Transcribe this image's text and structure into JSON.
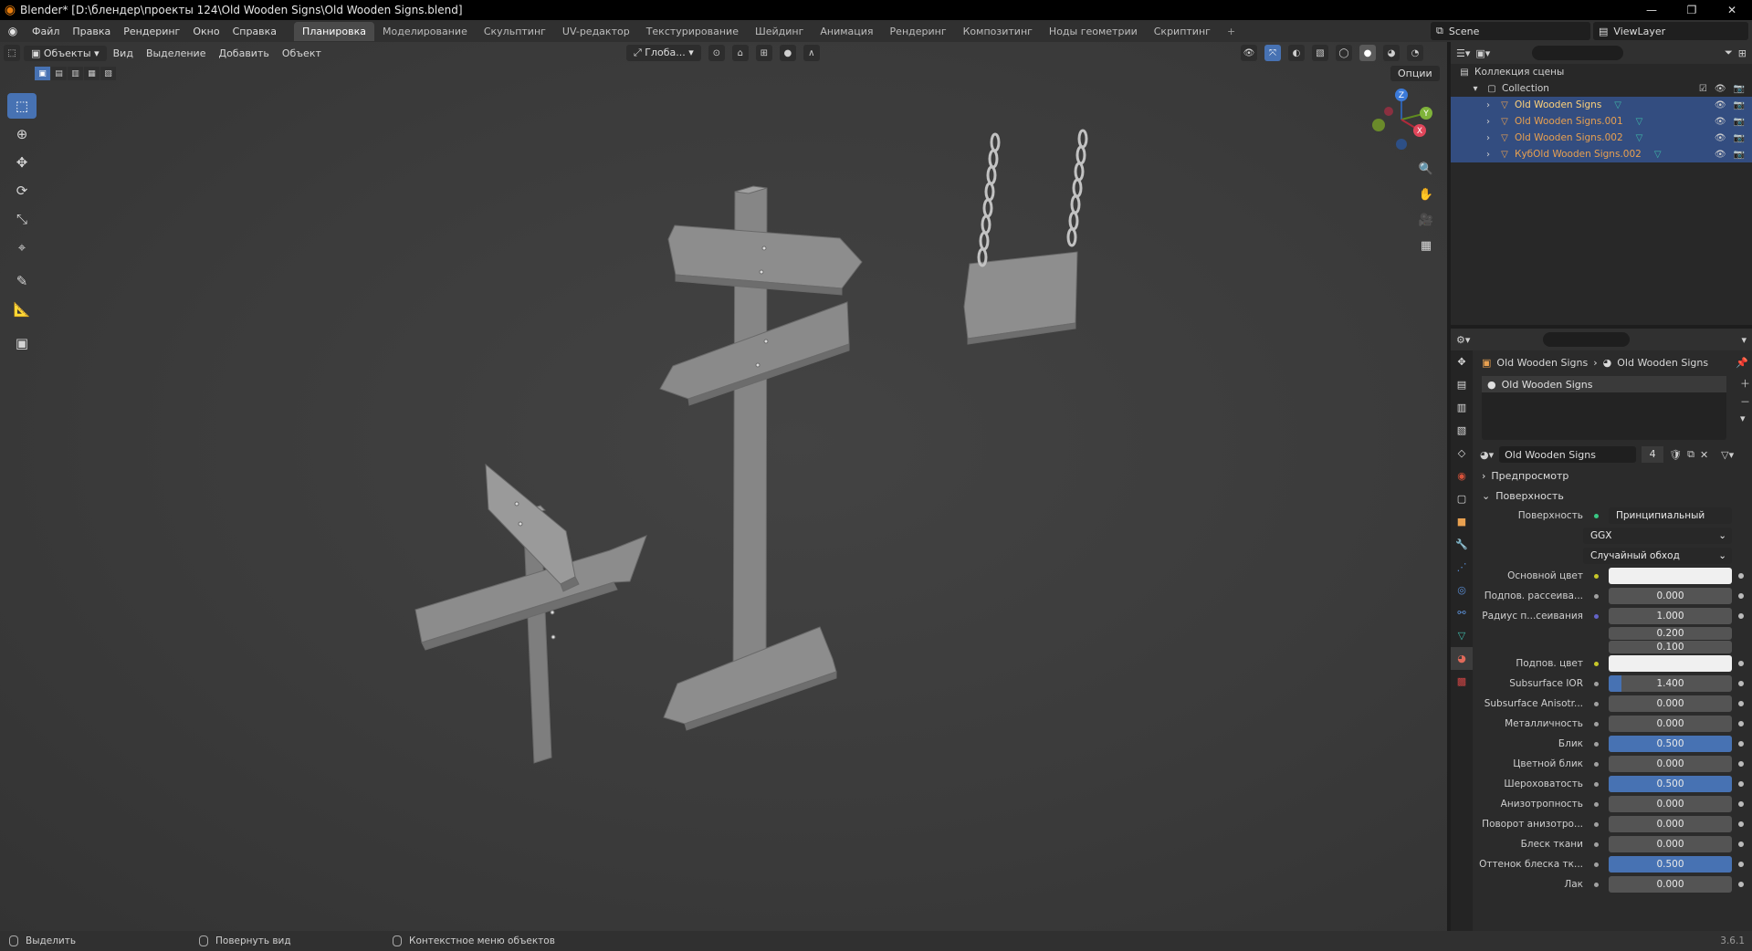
{
  "window": {
    "title": "Blender* [D:\\блендер\\проекты 124\\Old Wooden Signs\\Old Wooden Signs.blend]",
    "minimize": "—",
    "maximize": "❐",
    "close": "✕"
  },
  "topbar": {
    "menu": [
      "Файл",
      "Правка",
      "Рендеринг",
      "Окно",
      "Справка"
    ],
    "workspaces": [
      {
        "label": "Планировка",
        "active": true
      },
      {
        "label": "Моделирование",
        "active": false
      },
      {
        "label": "Скульптинг",
        "active": false
      },
      {
        "label": "UV-редактор",
        "active": false
      },
      {
        "label": "Текстурирование",
        "active": false
      },
      {
        "label": "Шейдинг",
        "active": false
      },
      {
        "label": "Анимация",
        "active": false
      },
      {
        "label": "Рендеринг",
        "active": false
      },
      {
        "label": "Композитинг",
        "active": false
      },
      {
        "label": "Ноды геометрии",
        "active": false
      },
      {
        "label": "Скриптинг",
        "active": false
      }
    ],
    "add_workspace": "+",
    "scene": "Scene",
    "view_layer": "ViewLayer"
  },
  "viewport": {
    "mode": "Объекты",
    "menus": [
      "Вид",
      "Выделение",
      "Добавить",
      "Объект"
    ],
    "transform_orientation": "Глоба...",
    "options": "Опции",
    "gizmo": {
      "x": "X",
      "y": "Y",
      "z": "Z"
    }
  },
  "toolbar": {
    "tools": [
      {
        "name": "select-box-tool",
        "icon": "select-box-icon",
        "glyph": "⬚",
        "active": true
      },
      {
        "name": "cursor-tool",
        "icon": "cursor-icon",
        "glyph": "⊕",
        "active": false
      },
      {
        "name": "move-tool",
        "icon": "move-icon",
        "glyph": "✥",
        "active": false
      },
      {
        "name": "rotate-tool",
        "icon": "rotate-icon",
        "glyph": "⟳",
        "active": false
      },
      {
        "name": "scale-tool",
        "icon": "scale-icon",
        "glyph": "⤡",
        "active": false
      },
      {
        "name": "transform-tool",
        "icon": "transform-icon",
        "glyph": "⌖",
        "active": false
      },
      {
        "name": "annotate-tool",
        "icon": "annotate-icon",
        "glyph": "✎",
        "active": false
      },
      {
        "name": "measure-tool",
        "icon": "measure-icon",
        "glyph": "📐",
        "active": false
      },
      {
        "name": "add-cube-tool",
        "icon": "add-cube-icon",
        "glyph": "▣",
        "active": false
      }
    ]
  },
  "outliner": {
    "scene_collection": "Коллекция сцены",
    "collection": "Collection",
    "objects": [
      {
        "name": "Old Wooden Signs",
        "selected": true,
        "active": true
      },
      {
        "name": "Old Wooden Signs.001",
        "selected": true,
        "active": false
      },
      {
        "name": "Old Wooden Signs.002",
        "selected": true,
        "active": false
      },
      {
        "name": "КубOld Wooden Signs.002",
        "selected": true,
        "active": false
      }
    ]
  },
  "properties": {
    "breadcrumb_object": "Old Wooden Signs",
    "breadcrumb_material": "Old Wooden Signs",
    "slot_name": "Old Wooden Signs",
    "material_name": "Old Wooden Signs",
    "users": "4",
    "preview_panel": "Предпросмотр",
    "surface_panel": "Поверхность",
    "surface_label": "Поверхность",
    "surface_value": "Принципиальный BSDF",
    "distribution": "GGX",
    "subsurface_method": "Случайный обход",
    "rows": [
      {
        "label": "Основной цвет",
        "value": "",
        "kind": "color",
        "dot": "yellow"
      },
      {
        "label": "Подпов. рассеива...",
        "value": "0.000",
        "kind": "num",
        "dot": "grey",
        "fill": 0
      },
      {
        "label": "Радиус п...сеивания",
        "value": "1.000",
        "kind": "num",
        "dot": "blue",
        "fill": 0
      },
      {
        "label": "",
        "value": "0.200",
        "kind": "num",
        "dot": "",
        "fill": 0
      },
      {
        "label": "",
        "value": "0.100",
        "kind": "num",
        "dot": "",
        "fill": 0
      },
      {
        "label": "Подпов. цвет",
        "value": "",
        "kind": "color",
        "dot": "yellow"
      },
      {
        "label": "Subsurface IOR",
        "value": "1.400",
        "kind": "num",
        "dot": "grey",
        "fill": 0.1
      },
      {
        "label": "Subsurface Anisotr...",
        "value": "0.000",
        "kind": "num",
        "dot": "grey",
        "fill": 0
      },
      {
        "label": "Металличность",
        "value": "0.000",
        "kind": "num",
        "dot": "grey",
        "fill": 0
      },
      {
        "label": "Блик",
        "value": "0.500",
        "kind": "num",
        "dot": "grey",
        "fill": 1
      },
      {
        "label": "Цветной блик",
        "value": "0.000",
        "kind": "num",
        "dot": "grey",
        "fill": 0
      },
      {
        "label": "Шероховатость",
        "value": "0.500",
        "kind": "num",
        "dot": "grey",
        "fill": 1
      },
      {
        "label": "Анизотропность",
        "value": "0.000",
        "kind": "num",
        "dot": "grey",
        "fill": 0
      },
      {
        "label": "Поворот анизотро...",
        "value": "0.000",
        "kind": "num",
        "dot": "grey",
        "fill": 0
      },
      {
        "label": "Блеск ткани",
        "value": "0.000",
        "kind": "num",
        "dot": "grey",
        "fill": 0
      },
      {
        "label": "Оттенок блеска тк...",
        "value": "0.500",
        "kind": "num",
        "dot": "grey",
        "fill": 1
      },
      {
        "label": "Лак",
        "value": "0.000",
        "kind": "num",
        "dot": "grey",
        "fill": 0
      }
    ]
  },
  "statusbar": {
    "select": "Выделить",
    "rotate_view": "Повернуть вид",
    "context_menu": "Контекстное меню объектов",
    "version": "3.6.1"
  },
  "colors": {
    "accent": "#4772b3",
    "selected_row": "#334d80",
    "object_name": "#e8a050",
    "mesh_icon": "#3fb8a8"
  }
}
